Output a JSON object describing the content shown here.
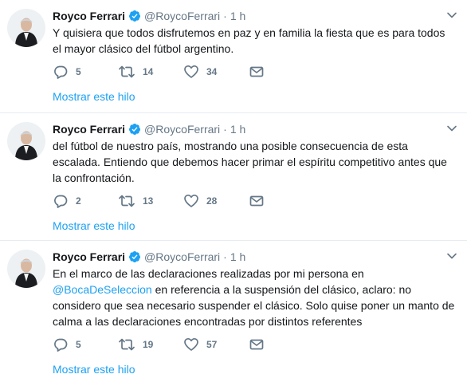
{
  "tweets": [
    {
      "name": "Royco Ferrari",
      "handle": "@RoycoFerrari",
      "separator": "·",
      "time": "1 h",
      "text": "Y quisiera que todos disfrutemos en paz y en familia la fiesta que es para todos el mayor clásico del fútbol argentino.",
      "replies": "5",
      "retweets": "14",
      "likes": "34",
      "show_thread": "Mostrar este hilo"
    },
    {
      "name": "Royco Ferrari",
      "handle": "@RoycoFerrari",
      "separator": "·",
      "time": "1 h",
      "text": "del fútbol de nuestro país, mostrando una posible consecuencia de esta escalada. Entiendo que debemos hacer primar el espíritu competitivo antes que la confrontación.",
      "replies": "2",
      "retweets": "13",
      "likes": "28",
      "show_thread": "Mostrar este hilo"
    },
    {
      "name": "Royco Ferrari",
      "handle": "@RoycoFerrari",
      "separator": "·",
      "time": "1 h",
      "text_before": "En el marco de las declaraciones realizadas por mi persona en ",
      "mention": "@BocaDeSeleccion",
      "text_after": " en referencia a la suspensión del clásico, aclaro: no considero que sea necesario suspender el clásico. Solo quise poner un manto de calma a las declaraciones encontradas por distintos referentes",
      "replies": "5",
      "retweets": "19",
      "likes": "57",
      "show_thread": "Mostrar este hilo"
    }
  ],
  "colors": {
    "link": "#1da1f2",
    "secondary_text": "#657786",
    "divider": "#e6ecf0",
    "verified": "#1da1f2"
  },
  "icons": [
    "avatar-photo",
    "verified-badge-icon",
    "caret-down-icon",
    "reply-icon",
    "retweet-icon",
    "like-icon",
    "direct-message-icon"
  ]
}
